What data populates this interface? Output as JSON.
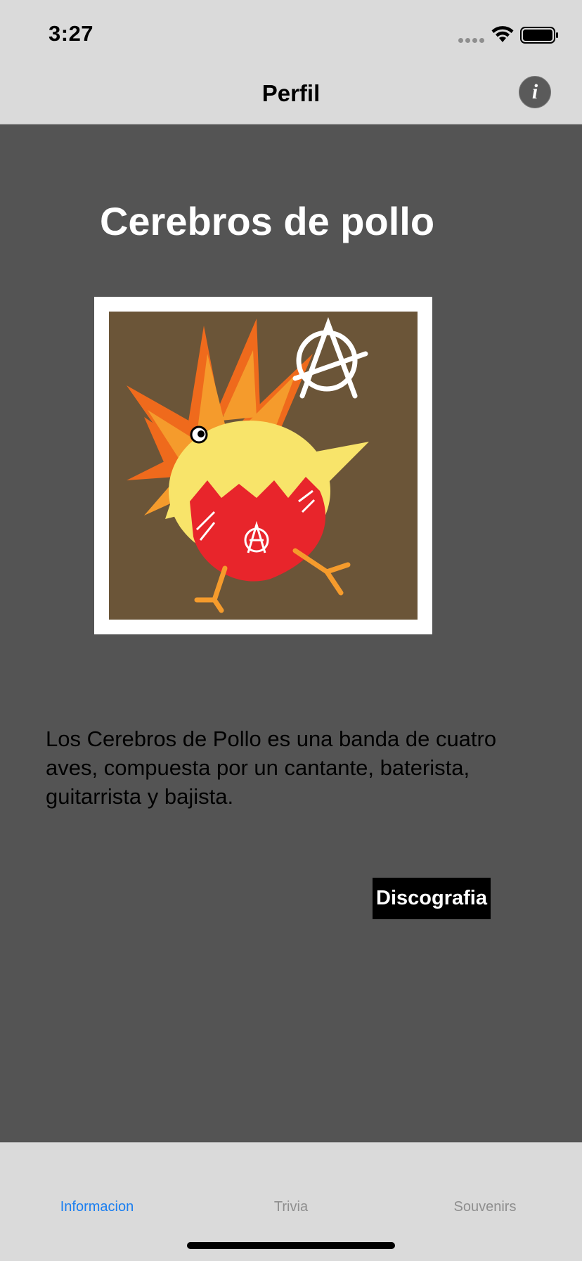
{
  "status_bar": {
    "time": "3:27"
  },
  "nav": {
    "title": "Perfil",
    "info_icon": "info-icon"
  },
  "content": {
    "title": "Cerebros de pollo",
    "description": "Los Cerebros de Pollo es una banda de cuatro aves, compuesta por un cantante, baterista, guitarrista y bajista.",
    "button_label": "Discografia"
  },
  "tabs": [
    {
      "label": "Informacion",
      "selected": true
    },
    {
      "label": "Trivia",
      "selected": false
    },
    {
      "label": "Souvenirs",
      "selected": false
    }
  ],
  "colors": {
    "accent": "#1a7ef0",
    "background": "#545454",
    "bar": "#dadada"
  }
}
